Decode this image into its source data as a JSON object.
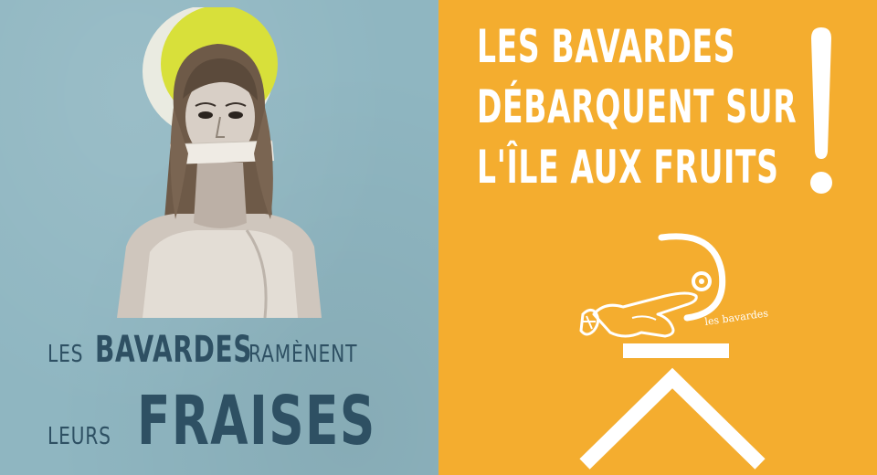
{
  "left": {
    "line1_small_a": "LES",
    "line1_big": "BAVARDES",
    "line1_small_b": "RAMÈNENT",
    "line2_small": "LEURS",
    "line2_big": "FRAISES"
  },
  "right": {
    "headline": [
      "LES BAVARDES",
      "DÉBARQUENT SUR",
      "L'ÎLE AUX FRUITS"
    ],
    "exclamation": "!",
    "logo_text": "les bavardes"
  },
  "colors": {
    "left_background": "#8fb6c1",
    "right_background": "#f4ad2f",
    "left_text": "#2e5063",
    "right_text": "#ffffff",
    "halo_yellow": "#d8e03a"
  }
}
